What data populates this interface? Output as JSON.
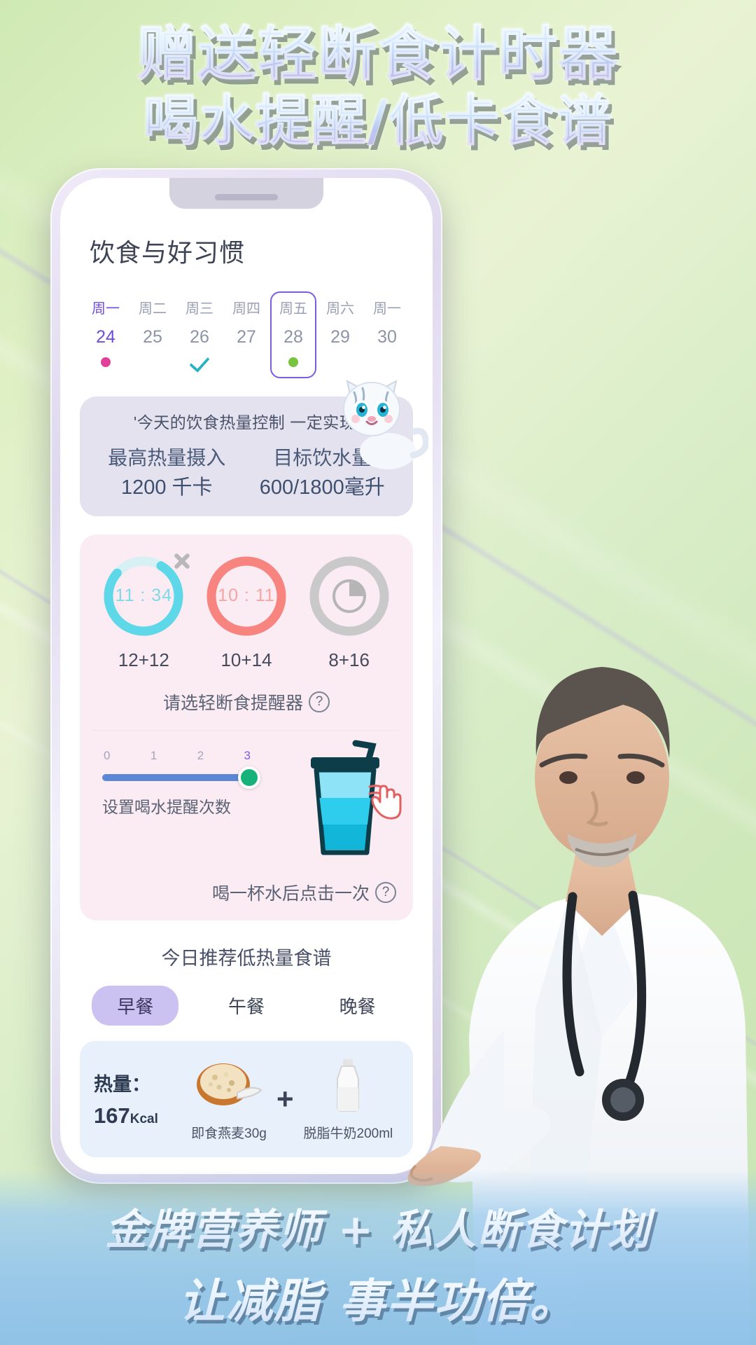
{
  "promo": {
    "headline_line1": "赠送轻断食计时器",
    "headline_line2": "喝水提醒/低卡食谱",
    "footer_line1": "金牌营养师 + 私人断食计划",
    "footer_line2": "让减脂 事半功倍。"
  },
  "app": {
    "page_title": "饮食与好习惯",
    "week": [
      {
        "weekday": "周一",
        "date": "24",
        "mark": "pink-dot"
      },
      {
        "weekday": "周二",
        "date": "25",
        "mark": "none"
      },
      {
        "weekday": "周三",
        "date": "26",
        "mark": "check"
      },
      {
        "weekday": "周四",
        "date": "27",
        "mark": "none"
      },
      {
        "weekday": "周五",
        "date": "28",
        "mark": "green-dot"
      },
      {
        "weekday": "周六",
        "date": "29",
        "mark": "none"
      },
      {
        "weekday": "周一",
        "date": "30",
        "mark": "none"
      }
    ],
    "goal": {
      "quote": "'今天的饮食热量控制 一定实现'",
      "calorie_label": "最高热量摄入",
      "calorie_value": "1200 千卡",
      "water_label": "目标饮水量",
      "water_value": "600/1800毫升"
    },
    "fasting": {
      "timers": [
        {
          "time": "11 : 34",
          "plan": "12+12",
          "color": "#5ed7e8",
          "progress": 0.78,
          "state": "running"
        },
        {
          "time": "10 : 11",
          "plan": "10+14",
          "color": "#f8847f",
          "progress": 1.0,
          "state": "running"
        },
        {
          "time": "",
          "plan": "8+16",
          "color": "#c9c9c9",
          "progress": 1.0,
          "state": "idle"
        }
      ],
      "close_icon": "close-icon",
      "choose_label": "请选轻断食提醒器",
      "help_icon": "question-icon"
    },
    "water": {
      "ticks": [
        "0",
        "1",
        "2",
        "3"
      ],
      "selected_tick": "3",
      "slider_label": "设置喝水提醒次数",
      "tap_note": "喝一杯水后点击一次",
      "help_icon": "question-icon",
      "cup_icon": "water-cup-icon",
      "tap_hand_icon": "tap-hand-icon"
    },
    "recipes": {
      "title": "今日推荐低热量食谱",
      "tabs": [
        {
          "label": "早餐",
          "active": true
        },
        {
          "label": "午餐",
          "active": false
        },
        {
          "label": "晚餐",
          "active": false
        }
      ],
      "card": {
        "kcal_label": "热量：",
        "kcal_value": "167",
        "kcal_unit": "Kcal",
        "item1": "即食燕麦30g",
        "item2": "脱脂牛奶200ml",
        "plus": "+"
      }
    }
  }
}
